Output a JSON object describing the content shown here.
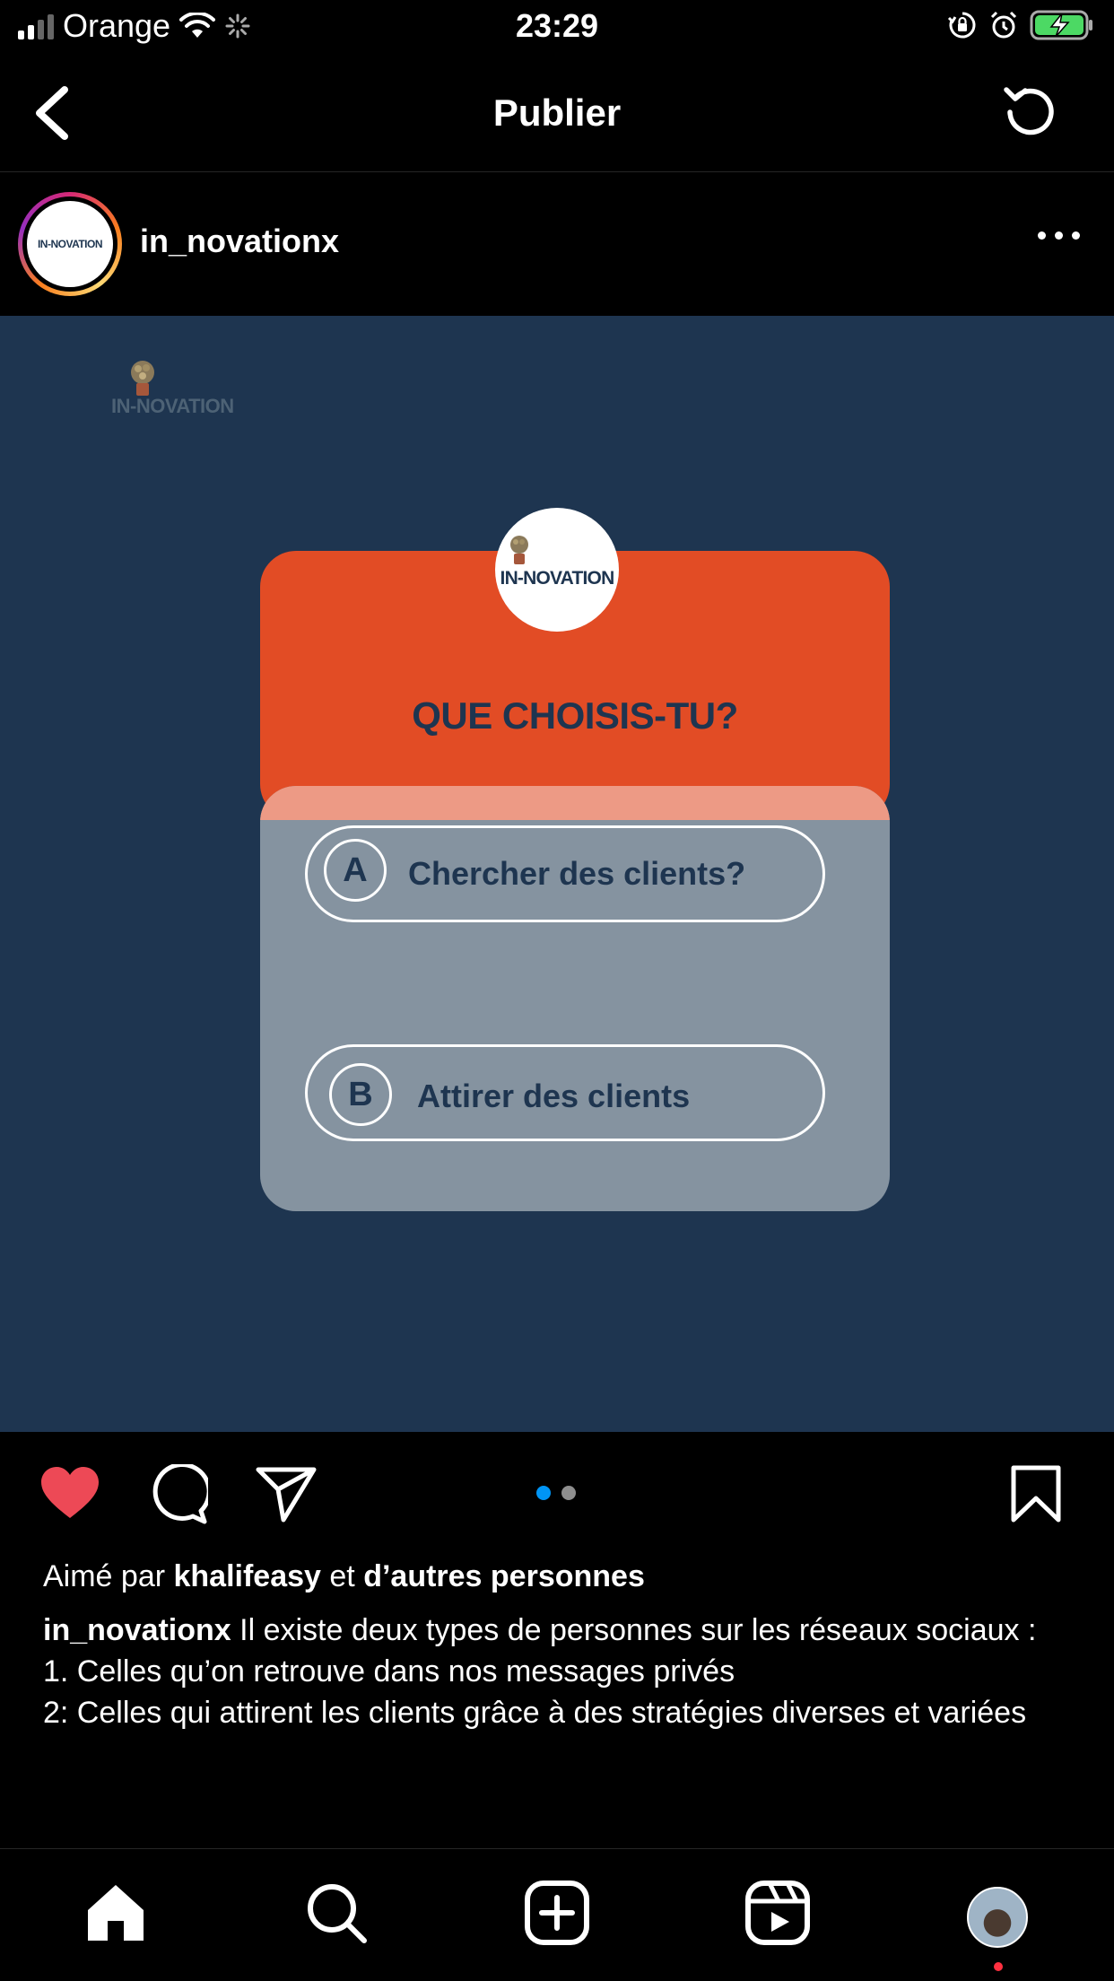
{
  "status_bar": {
    "carrier": "Orange",
    "time": "23:29"
  },
  "header": {
    "title": "Publier"
  },
  "post": {
    "username": "in_novationx",
    "image": {
      "corner_logo_text": "IN-NOVATION",
      "card_logo_text": "IN-NOVATION",
      "question": "QUE CHOISIS-TU?",
      "options": [
        {
          "letter": "A",
          "text": "Chercher des clients?"
        },
        {
          "letter": "B",
          "text": "Attirer des clients"
        }
      ]
    },
    "carousel": {
      "current": 1,
      "total": 2
    },
    "liked": true,
    "likes": {
      "prefix": "Aimé par ",
      "user": "khalifeasy",
      "middle": " et ",
      "others": "d’autres personnes"
    },
    "caption": {
      "author": "in_novationx",
      "text": " Il existe deux types de personnes sur les réseaux sociaux :\n1. Celles qu’on retrouve dans nos messages privés\n2: Celles qui attirent les clients grâce à des stratégies diverses et variées"
    }
  },
  "tab_bar": {
    "items": [
      "home-icon",
      "search-icon",
      "new-post-icon",
      "reels-icon",
      "profile-avatar"
    ]
  },
  "colors": {
    "post_bg": "#1e3550",
    "card_orange": "#e24c25",
    "card_grey": "#8593a0",
    "like_red": "#ed4956",
    "active_dot": "#0095f6"
  }
}
